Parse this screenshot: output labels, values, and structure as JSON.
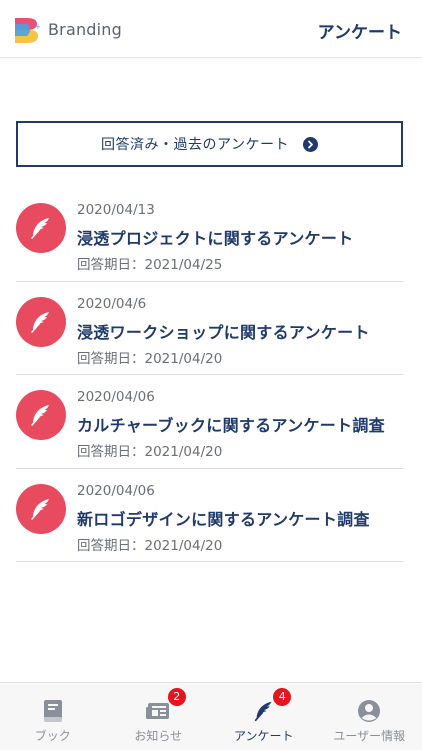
{
  "header": {
    "brand": "Branding",
    "title": "アンケート"
  },
  "past_button": {
    "label": "回答済み・過去のアンケート"
  },
  "surveys": [
    {
      "date": "2020/04/13",
      "title": "浸透プロジェクトに関するアンケート",
      "deadline": "回答期日：2021/04/25"
    },
    {
      "date": "2020/04/6",
      "title": "浸透ワークショップに関するアンケート",
      "deadline": "回答期日：2021/04/20"
    },
    {
      "date": "2020/04/06",
      "title": "カルチャーブックに関するアンケート調査",
      "deadline": "回答期日：2021/04/20"
    },
    {
      "date": "2020/04/06",
      "title": "新ロゴデザインに関するアンケート調査",
      "deadline": "回答期日：2021/04/20"
    }
  ],
  "tabbar": {
    "tabs": [
      {
        "label": "ブック",
        "icon": "book-icon"
      },
      {
        "label": "お知らせ",
        "icon": "news-icon",
        "badge": "2"
      },
      {
        "label": "アンケート",
        "icon": "quill-icon",
        "badge": "4",
        "active": true
      },
      {
        "label": "ユーザー情報",
        "icon": "user-icon"
      }
    ]
  },
  "colors": {
    "navy": "#1f3a6b",
    "survey_icon_bg": "#e84a5f",
    "badge": "#e3151f",
    "logo_pink": "#e8507a",
    "logo_blue": "#4aa3df",
    "logo_yellow": "#f4c542"
  }
}
